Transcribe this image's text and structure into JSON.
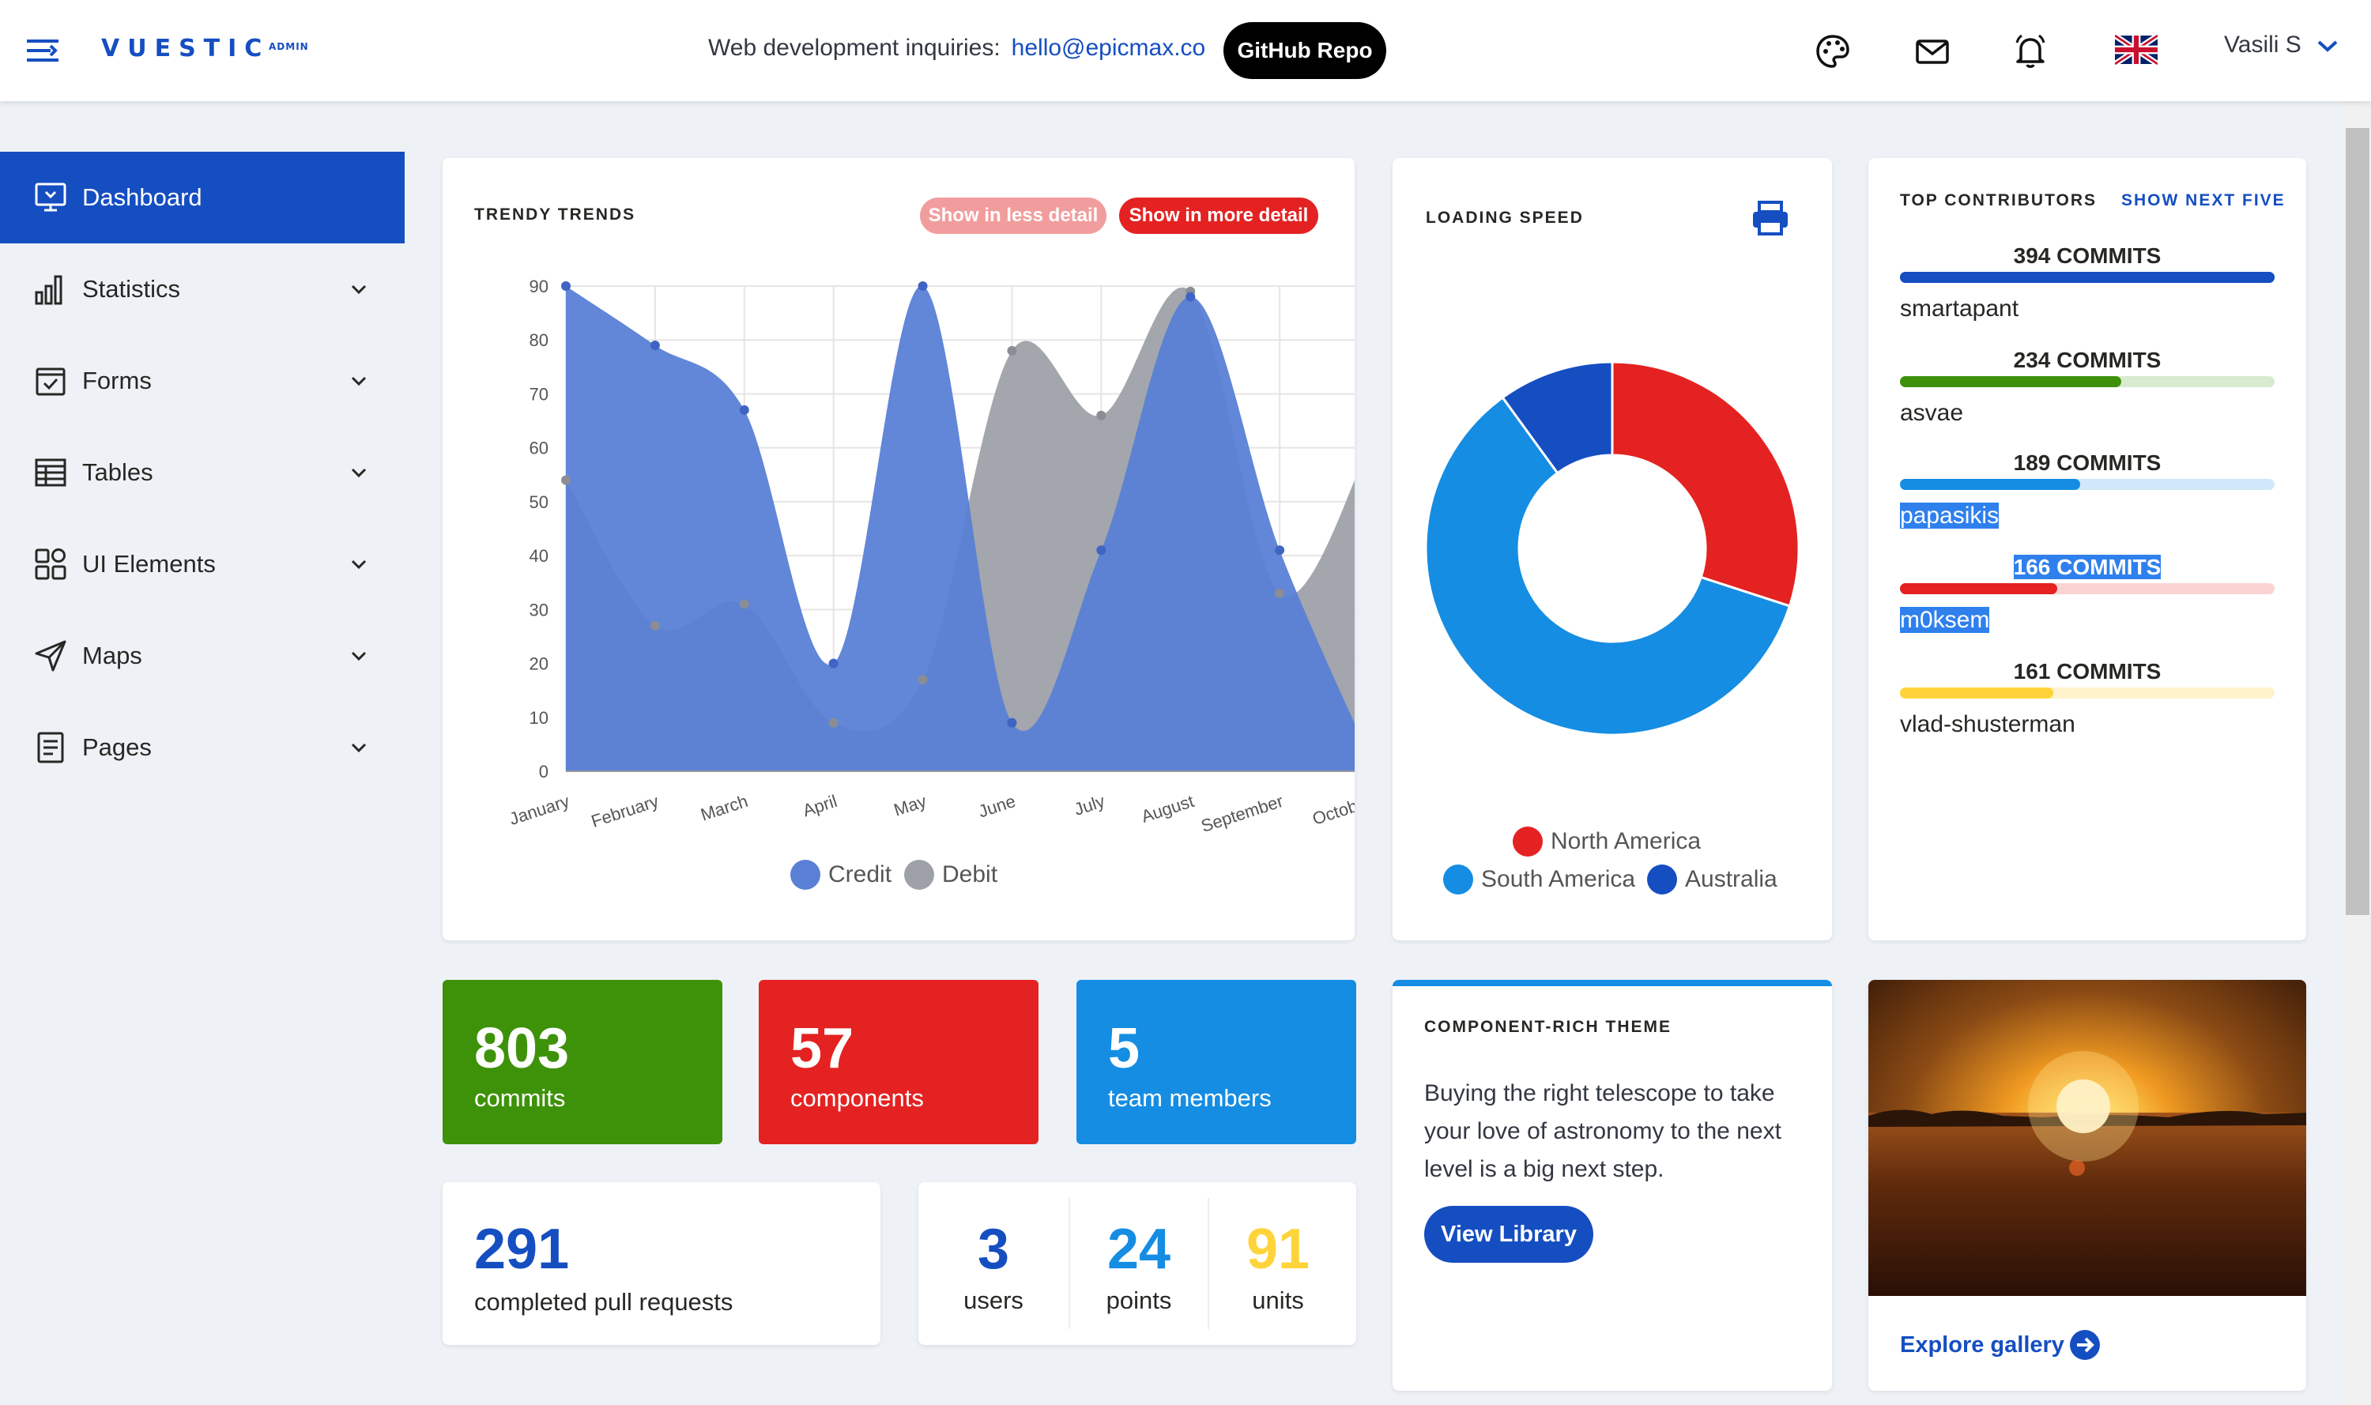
{
  "header": {
    "logo": "VUESTIC",
    "logo_sup": "ADMIN",
    "inquiry_text": "Web development inquiries:",
    "inquiry_email": "hello@epicmax.co",
    "github_label": "GitHub Repo",
    "user_name": "Vasili S"
  },
  "sidebar": {
    "items": [
      {
        "label": "Dashboard",
        "icon": "monitor-icon",
        "active": true
      },
      {
        "label": "Statistics",
        "icon": "bar-chart-icon"
      },
      {
        "label": "Forms",
        "icon": "checkbox-form-icon"
      },
      {
        "label": "Tables",
        "icon": "table-icon"
      },
      {
        "label": "UI Elements",
        "icon": "ui-elements-icon"
      },
      {
        "label": "Maps",
        "icon": "map-arrow-icon"
      },
      {
        "label": "Pages",
        "icon": "document-icon"
      }
    ]
  },
  "trends": {
    "title": "TRENDY TRENDS",
    "less_detail_label": "Show in less detail",
    "more_detail_label": "Show in more detail"
  },
  "loading_speed": {
    "title": "LOADING SPEED"
  },
  "contributors": {
    "title": "TOP CONTRIBUTORS",
    "next_label": "SHOW NEXT FIVE",
    "list": [
      {
        "commits": "394 COMMITS",
        "name": "smartapant",
        "fraction": 1.0,
        "color": "#154ec1",
        "bg": "#154ec1"
      },
      {
        "commits": "234 COMMITS",
        "name": "asvae",
        "fraction": 0.59,
        "color": "#3d9209",
        "bg": "#d8ead0"
      },
      {
        "commits": "189 COMMITS",
        "name": "papasikis",
        "fraction": 0.48,
        "color": "#158de3",
        "bg": "#d0e8f9"
      },
      {
        "commits": "166 COMMITS",
        "name": "m0ksem",
        "fraction": 0.42,
        "color": "#e42222",
        "bg": "#fad3d3"
      },
      {
        "commits": "161 COMMITS",
        "name": "vlad-shusterman",
        "fraction": 0.41,
        "color": "#ffd43a",
        "bg": "#fff3cc"
      }
    ]
  },
  "tiles": [
    {
      "value": "803",
      "label": "commits",
      "color": "#3d9209"
    },
    {
      "value": "57",
      "label": "components",
      "color": "#e42222"
    },
    {
      "value": "5",
      "label": "team members",
      "color": "#158de3"
    }
  ],
  "pull_requests": {
    "value": "291",
    "label": "completed pull requests"
  },
  "mini_stats": [
    {
      "value": "3",
      "label": "users",
      "color": "#154ec1"
    },
    {
      "value": "24",
      "label": "points",
      "color": "#158de3"
    },
    {
      "value": "91",
      "label": "units",
      "color": "#ffd43a"
    }
  ],
  "theme_card": {
    "title": "COMPONENT-RICH THEME",
    "text_lines": [
      "Buying the right telescope to take",
      "your love of astronomy to the next",
      "level is a big next step."
    ],
    "button_label": "View Library"
  },
  "gallery": {
    "link_label": "Explore gallery"
  },
  "colors": {
    "primary": "#154ec1",
    "success": "#3d9209",
    "danger": "#e42222",
    "info": "#158de3",
    "warning": "#ffd43a"
  },
  "chart_data": [
    {
      "type": "area",
      "categories": [
        "January",
        "February",
        "March",
        "April",
        "May",
        "June",
        "July",
        "August",
        "September",
        "October"
      ],
      "ylim": [
        0,
        90
      ],
      "yticks": [
        0,
        10,
        20,
        30,
        40,
        50,
        60,
        70,
        80,
        90
      ],
      "grid": true,
      "legend": "bottom",
      "series": [
        {
          "name": "Credit",
          "color": "#5a80d6",
          "values": [
            90,
            79,
            67,
            20,
            90,
            9,
            41,
            88,
            41,
            3
          ]
        },
        {
          "name": "Debit",
          "color": "#9ea1a8",
          "values": [
            54,
            27,
            31,
            9,
            17,
            78,
            66,
            89,
            33,
            60
          ]
        }
      ]
    },
    {
      "type": "pie",
      "donut": true,
      "labels": [
        "North America",
        "South America",
        "Australia"
      ],
      "values": [
        30,
        60,
        10
      ],
      "colors": [
        "#e42222",
        "#158de3",
        "#154ec1"
      ],
      "legend": "bottom"
    }
  ]
}
